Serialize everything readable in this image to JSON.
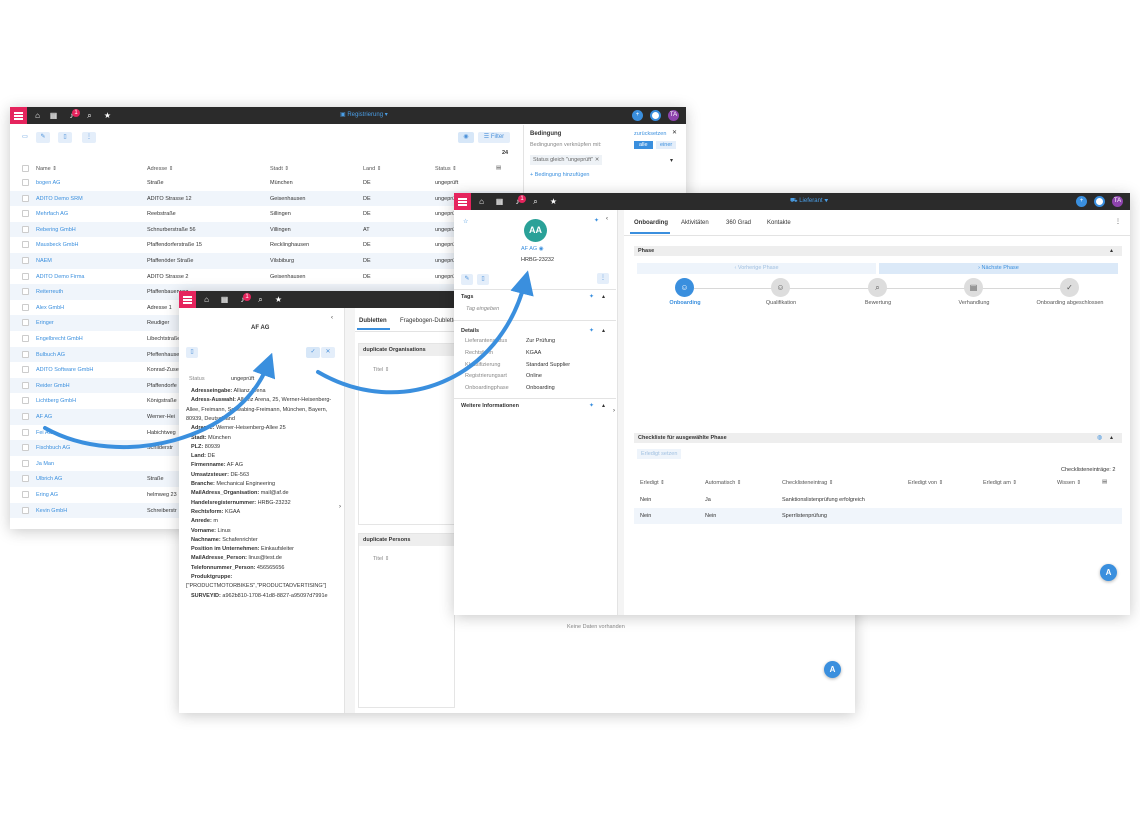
{
  "colors": {
    "accent": "#3a8fde",
    "brand": "#e5245d",
    "topbar": "#2b2b2b",
    "avatar": "#8e44ad",
    "avatar_big": "#2aa198"
  },
  "topbar": {
    "bell_count": "1",
    "user_initials": "TA"
  },
  "window1": {
    "context_label": "Registrierung",
    "filter_label": "Filter",
    "count": "24",
    "columns": [
      "Name",
      "Adresse",
      "Stadt",
      "Land",
      "Status"
    ],
    "rows": [
      {
        "name": "bogen AG",
        "address": "Straße",
        "city": "München",
        "country": "DE",
        "status": "ungeprüft"
      },
      {
        "name": "ADITO Demo SRM",
        "address": "ADITO Strasse 12",
        "city": "Geisenhausen",
        "country": "DE",
        "status": "ungeprüft"
      },
      {
        "name": "Mehrfach AG",
        "address": "Reebstraße",
        "city": "Sillingen",
        "country": "DE",
        "status": "ungeprüft"
      },
      {
        "name": "Rebering GmbH",
        "address": "Schnurberstraße 56",
        "city": "Villingen",
        "country": "AT",
        "status": "ungeprüft"
      },
      {
        "name": "Mausbeck GmbH",
        "address": "Pfaffendorferstraße 15",
        "city": "Recklinghausen",
        "country": "DE",
        "status": "ungeprüft"
      },
      {
        "name": "NAEM",
        "address": "Pfaffenöder Straße",
        "city": "Vilsbiburg",
        "country": "DE",
        "status": "ungeprüft"
      },
      {
        "name": "ADITO Demo Firma",
        "address": "ADITO Strasse 2",
        "city": "Geisenhausen",
        "country": "DE",
        "status": "ungeprüft"
      },
      {
        "name": "Reiterreuth",
        "address": "Pfaffenbauerweg",
        "city": "",
        "country": "",
        "status": ""
      },
      {
        "name": "Alex GmbH",
        "address": "Adresse 1",
        "city": "",
        "country": "",
        "status": ""
      },
      {
        "name": "Eringer",
        "address": "Reudiger",
        "city": "",
        "country": "",
        "status": ""
      },
      {
        "name": "Engelbrecht GmbH",
        "address": "Libechtstraße",
        "city": "",
        "country": "",
        "status": ""
      },
      {
        "name": "Bulbuch AG",
        "address": "Pfeffenhause",
        "city": "",
        "country": "",
        "status": ""
      },
      {
        "name": "ADITO Software GmbH",
        "address": "Konrad-Zuse",
        "city": "",
        "country": "",
        "status": ""
      },
      {
        "name": "Reider GmbH",
        "address": "Pfaffendorfe",
        "city": "",
        "country": "",
        "status": ""
      },
      {
        "name": "Lichtberg GmbH",
        "address": "Königstraße",
        "city": "",
        "country": "",
        "status": ""
      },
      {
        "name": "AF AG",
        "address": "Werner-Hei",
        "city": "",
        "country": "",
        "status": ""
      },
      {
        "name": "Fei AG",
        "address": "Habichtweg",
        "city": "",
        "country": "",
        "status": ""
      },
      {
        "name": "Fischbuch AG",
        "address": "Schilderstr",
        "city": "",
        "country": "",
        "status": ""
      },
      {
        "name": "Ja Man",
        "address": "",
        "city": "",
        "country": "",
        "status": ""
      },
      {
        "name": "Ulbrich AG",
        "address": "Straße",
        "city": "",
        "country": "",
        "status": ""
      },
      {
        "name": "Ering AG",
        "address": "helmweg 23",
        "city": "",
        "country": "",
        "status": ""
      },
      {
        "name": "Kevin GmbH",
        "address": "Schreiberstr",
        "city": "",
        "country": "",
        "status": ""
      }
    ],
    "condition": {
      "title": "Bedingung",
      "reset": "zurücksetzen",
      "link_label": "Bedingungen verknüpfen mit:",
      "all": "alle",
      "one": "einer",
      "chip": "Status gleich \"ungeprüft\"",
      "add": "Bedingung hinzufügen"
    }
  },
  "window2": {
    "title": "AF AG",
    "tabs": [
      "Dubletten",
      "Fragebogen-Dublette"
    ],
    "dup_org": "duplicate Organisations",
    "dup_person": "duplicate Persons",
    "col_title": "Titel",
    "no_data": "Keine Daten vorhanden",
    "status_label": "Status",
    "status_value": "ungeprüft",
    "fields": [
      {
        "k": "Adresseingabe:",
        "v": "Allianz Arena"
      },
      {
        "k": "Adress-Auswahl:",
        "v": "Allianz Arena, 25, Werner-Heisenberg-"
      },
      {
        "k": "",
        "v": "Allee, Freimann, Schwabing-Freimann, München, Bayern,"
      },
      {
        "k": "",
        "v": "80939, Deutschland"
      },
      {
        "k": "Adresse:",
        "v": "Werner-Heisenberg-Allee 25"
      },
      {
        "k": "Stadt:",
        "v": "München"
      },
      {
        "k": "PLZ:",
        "v": "80939"
      },
      {
        "k": "Land:",
        "v": "DE"
      },
      {
        "k": "Firmenname:",
        "v": "AF AG"
      },
      {
        "k": "Umsatzsteuer:",
        "v": "DE-563"
      },
      {
        "k": "Branche:",
        "v": "Mechanical Engineering"
      },
      {
        "k": "MailAdress_Organisation:",
        "v": "mail@af.de"
      },
      {
        "k": "Handelsregisternummer:",
        "v": "HRBG-23232"
      },
      {
        "k": "Rechtsform:",
        "v": "KGAA"
      },
      {
        "k": "Anrede:",
        "v": "m"
      },
      {
        "k": "Vorname:",
        "v": "Linus"
      },
      {
        "k": "Nachname:",
        "v": "Schafenrichter"
      },
      {
        "k": "Position im Unternehmen:",
        "v": "Einkaufsleiter"
      },
      {
        "k": "MailAdresse_Person:",
        "v": "linus@test.de"
      },
      {
        "k": "Telefonnummer_Person:",
        "v": "456565656"
      },
      {
        "k": "Produktgruppe:",
        "v": ""
      },
      {
        "k": "",
        "v": "[\"PRODUCTMOTORBIKES\",\"PRODUCTADVERTISING\"]"
      },
      {
        "k": "SURVEYID:",
        "v": "a962b810-1708-41d8-8827-a95097d7991e"
      }
    ]
  },
  "window3": {
    "context_label": "Lieferant",
    "avatar": "AA",
    "name": "AF AG",
    "hrb": "HRBG-23232",
    "tags_title": "Tags",
    "tags_placeholder": "Tag eingeben",
    "details_title": "Details",
    "details": [
      {
        "k": "Lieferantenstatus",
        "v": "Zur Prüfung"
      },
      {
        "k": "Rechtsform",
        "v": "KGAA"
      },
      {
        "k": "Klassifizierung",
        "v": "Standard Supplier"
      },
      {
        "k": "Registrierungsart",
        "v": "Online"
      },
      {
        "k": "Onboardingphase",
        "v": "Onboarding"
      }
    ],
    "more_info": "Weitere Informationen",
    "tabs": [
      "Onboarding",
      "Aktivitäten",
      "360 Grad",
      "Kontakte"
    ],
    "phase_title": "Phase",
    "prev_phase": "Vorherige Phase",
    "next_phase": "Nächste Phase",
    "steps": [
      "Onboarding",
      "Qualifikation",
      "Bewertung",
      "Verhandlung",
      "Onboarding abgeschlossen"
    ],
    "checklist_title": "Checkliste für ausgewählte Phase",
    "checklist_btn": "Erledigt setzen",
    "checklist_count": "Checklisteneinträge: 2",
    "checklist_columns": [
      "Erledigt",
      "Automatisch",
      "Checklisteneintrag",
      "Erledigt von",
      "Erledigt am",
      "Wissen"
    ],
    "checklist_rows": [
      {
        "done": "Nein",
        "auto": "Ja",
        "entry": "Sanktionslistenprüfung erfolgreich"
      },
      {
        "done": "Nein",
        "auto": "Nein",
        "entry": "Sperrlistenprüfung"
      }
    ]
  }
}
